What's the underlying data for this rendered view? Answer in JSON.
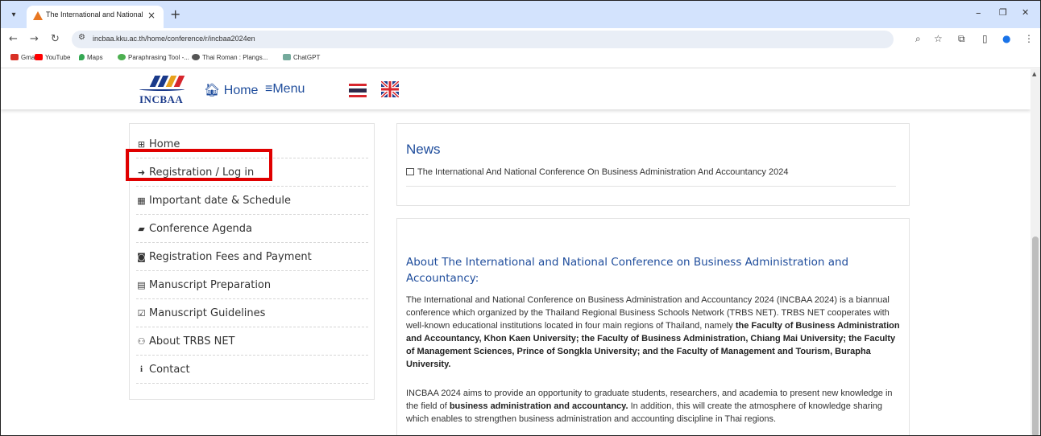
{
  "browser": {
    "tab_title": "The International and National",
    "tab_close": "×",
    "new_tab": "+",
    "url": "incbaa.kku.ac.th/home/conference/r/incbaa2024en",
    "win_minimize": "–",
    "win_restore": "❐",
    "win_close": "✕",
    "bookmarks": [
      {
        "label": "Gmail",
        "color": "#d93025"
      },
      {
        "label": "YouTube",
        "color": "#ff0000"
      },
      {
        "label": "Maps",
        "color": "#34a853"
      },
      {
        "label": "Paraphrasing Tool -...",
        "color": "#4caf50"
      },
      {
        "label": "Thai Roman : Plangs...",
        "color": "#555555"
      },
      {
        "label": "ChatGPT",
        "color": "#74aa9c"
      }
    ]
  },
  "header": {
    "logo_text": "INCBAA",
    "home_label": "Home",
    "menu_label": "Menu",
    "home_icon": "home-icon",
    "menu_icon": "hamburger-icon"
  },
  "sidebar": {
    "items": [
      {
        "label": "Home",
        "icon": "plus-square-icon",
        "glyph": "⊞"
      },
      {
        "label": "Registration / Log in",
        "icon": "sign-in-icon",
        "glyph": "➜"
      },
      {
        "label": "Important date & Schedule",
        "icon": "calendar-icon",
        "glyph": "▦"
      },
      {
        "label": "Conference Agenda",
        "icon": "book-icon",
        "glyph": "▰"
      },
      {
        "label": "Registration Fees and Payment",
        "icon": "money-icon",
        "glyph": "◙"
      },
      {
        "label": "Manuscript Preparation",
        "icon": "file-icon",
        "glyph": "▤"
      },
      {
        "label": "Manuscript Guidelines",
        "icon": "check-square-icon",
        "glyph": "☑"
      },
      {
        "label": "About TRBS NET",
        "icon": "users-icon",
        "glyph": "👥"
      },
      {
        "label": "Contact",
        "icon": "info-icon",
        "glyph": "i"
      }
    ]
  },
  "news": {
    "title": "News",
    "item": "The International And National Conference On Business Administration And Accountancy 2024"
  },
  "about": {
    "title": "About The International and National Conference on Business Administration and Accountancy:",
    "p1_a": "The International and National Conference on Business Administration and Accountancy 2024 (INCBAA 2024) is a biannual conference which organized by the Thailand Regional Business Schools Network (TRBS NET). TRBS NET cooperates with well-known educational institutions located in four main regions of Thailand, namely ",
    "p1_b": "the Faculty of Business Administration and Accountancy, Khon Kaen University; the Faculty of Business Administration, Chiang Mai University; the Faculty of Management Sciences, Prince of Songkla University; and the Faculty of Management and Tourism, Burapha University.",
    "p2_a": "INCBAA 2024 aims to provide an opportunity to graduate students, researchers, and academia to present new knowledge in the field of ",
    "p2_b": "business administration and accountancy.",
    "p2_c": " In addition, this will create the atmosphere of knowledge sharing which enables to strengthen business administration and accounting discipline in Thai regions."
  }
}
